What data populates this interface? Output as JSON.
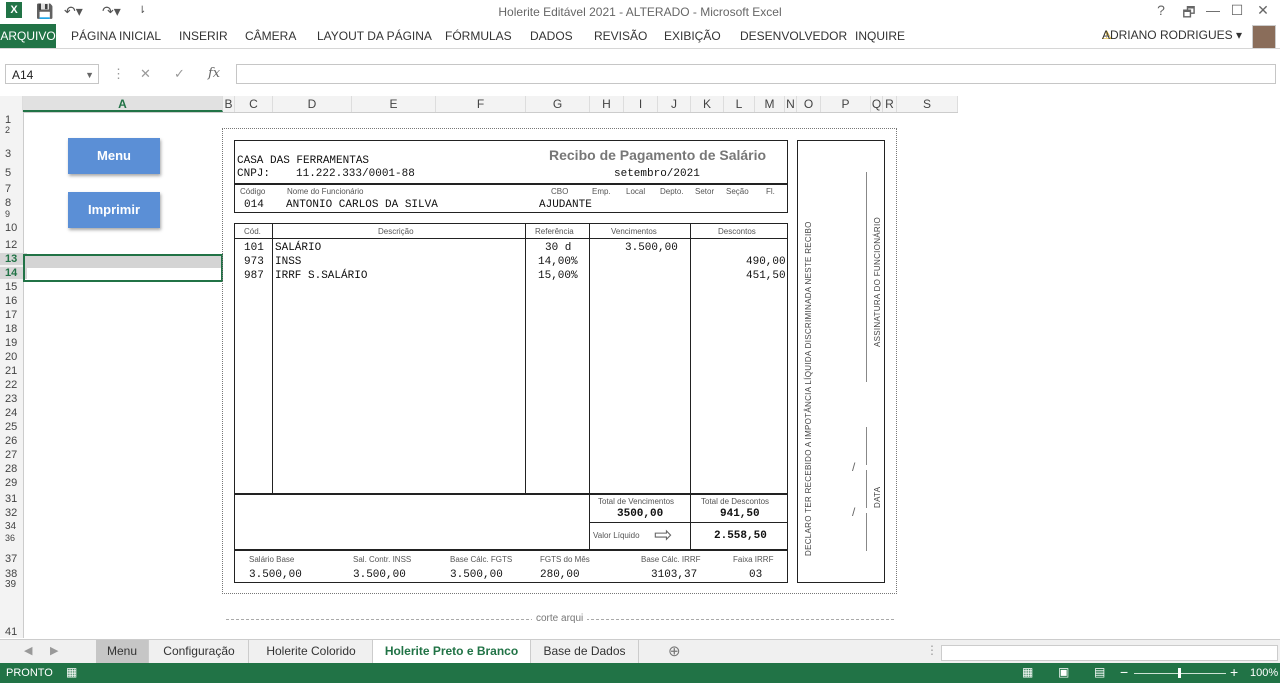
{
  "titlebar": {
    "title": "Holerite Editável 2021 - ALTERADO - Microsoft Excel",
    "help": "?",
    "restore": "🗗",
    "minimize": "—",
    "maximize": "☐",
    "close": "✕"
  },
  "ribbon": {
    "file": "ARQUIVO",
    "tabs": [
      "PÁGINA INICIAL",
      "INSERIR",
      "CÂMERA",
      "LAYOUT DA PÁGINA",
      "FÓRMULAS",
      "DADOS",
      "REVISÃO",
      "EXIBIÇÃO",
      "DESENVOLVEDOR",
      "INQUIRE"
    ],
    "user": "ADRIANO RODRIGUES"
  },
  "formula_bar": {
    "name_box": "A14",
    "value": ""
  },
  "columns": [
    "A",
    "B",
    "C",
    "D",
    "E",
    "F",
    "G",
    "H",
    "I",
    "J",
    "K",
    "L",
    "M",
    "N",
    "O",
    "P",
    "Q",
    "R",
    "S"
  ],
  "rows": [
    "1",
    "2",
    "3",
    "5",
    "7",
    "8",
    "9",
    "10",
    "12",
    "13",
    "14",
    "15",
    "16",
    "17",
    "18",
    "19",
    "20",
    "21",
    "22",
    "23",
    "24",
    "25",
    "26",
    "27",
    "28",
    "29",
    "31",
    "32",
    "34",
    "36",
    "37",
    "38",
    "39",
    "41"
  ],
  "buttons": {
    "menu": "Menu",
    "print": "Imprimir"
  },
  "receipt": {
    "company": "CASA DAS FERRAMENTAS",
    "cnpj_label": "CNPJ:",
    "cnpj": "11.222.333/0001-88",
    "title": "Recibo de Pagamento de Salário",
    "period": "setembro/2021",
    "labels": {
      "code": "Código",
      "employee": "Nome do Funcionário",
      "cbo": "CBO",
      "emp": "Emp.",
      "local": "Local",
      "dept": "Depto.",
      "sector": "Setor",
      "section": "Seção",
      "fl": "Fl."
    },
    "employee": {
      "code": "014",
      "name": "ANTONIO CARLOS DA SILVA",
      "cbo": "AJUDANTE"
    },
    "table_headers": {
      "code": "Cód.",
      "description": "Descrição",
      "reference": "Referência",
      "earnings": "Vencimentos",
      "deductions": "Descontos"
    },
    "items": [
      {
        "code": "101",
        "description": "SALÁRIO",
        "reference": "30 d",
        "earnings": "3.500,00",
        "deductions": ""
      },
      {
        "code": "973",
        "description": "INSS",
        "reference": "14,00%",
        "earnings": "",
        "deductions": "490,00"
      },
      {
        "code": "987",
        "description": "IRRF S.SALÁRIO",
        "reference": "15,00%",
        "earnings": "",
        "deductions": "451,50"
      }
    ],
    "totals": {
      "earnings_label": "Total de Vencimentos",
      "earnings": "3500,00",
      "deductions_label": "Total de Descontos",
      "deductions": "941,50",
      "net_label": "Valor Líquido",
      "net": "2.558,50"
    },
    "footer_labels": [
      "Salário Base",
      "Sal. Contr. INSS",
      "Base Cálc. FGTS",
      "FGTS do Mês",
      "Base Cálc. IRRF",
      "Faixa IRRF"
    ],
    "footer_values": [
      "3.500,00",
      "3.500,00",
      "3.500,00",
      "280,00",
      "3103,37",
      "03"
    ],
    "side_declaration": "DECLARO TER RECEBIDO A IMPOTÂNCIA LÍQUIDA DISCRIMINADA NESTE RECIBO",
    "side_signature": "ASSINATURA DO FUNCIONÁRIO",
    "side_date": "DATA",
    "cut_label": "corte arqui"
  },
  "sheet_tabs": [
    "Menu",
    "Configuração",
    "Holerite Colorido",
    "Holerite Preto e Branco",
    "Base de Dados"
  ],
  "active_sheet": "Holerite Preto e Branco",
  "status": {
    "ready": "PRONTO",
    "zoom": "100%"
  },
  "colors": {
    "excel_green": "#217346",
    "button_blue": "#5b8fd6"
  }
}
